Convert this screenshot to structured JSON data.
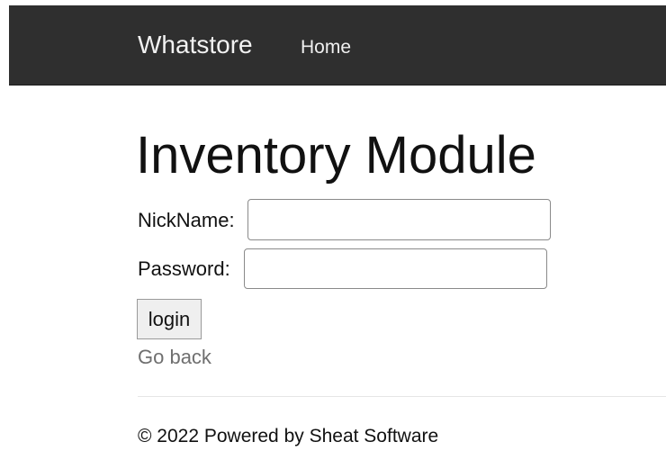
{
  "navbar": {
    "brand": "Whatstore",
    "links": [
      {
        "label": "Home"
      }
    ]
  },
  "main": {
    "title": "Inventory Module",
    "form": {
      "nickname": {
        "label": "NickName:",
        "value": "",
        "placeholder": ""
      },
      "password": {
        "label": "Password:",
        "value": "",
        "placeholder": ""
      },
      "submit_label": "login"
    },
    "go_back": "Go back"
  },
  "footer": {
    "text": "© 2022 Powered by Sheat Software"
  },
  "colors": {
    "navbar_background": "#2f2f2f",
    "navbar_text": "#f2f2f2",
    "link_muted": "#6f6f6f",
    "button_background": "#efefef"
  }
}
